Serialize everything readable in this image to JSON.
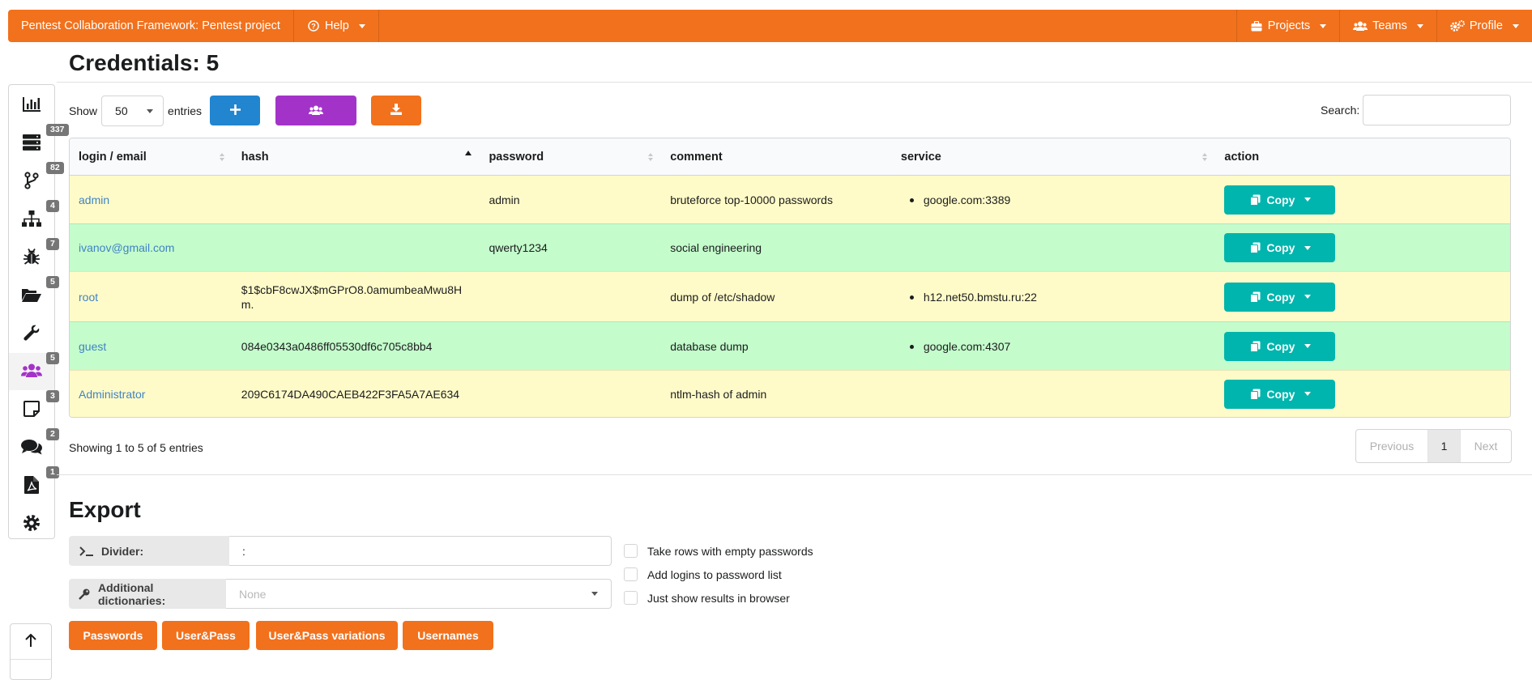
{
  "topbar": {
    "brand": "Pentest Collaboration Framework: Pentest project",
    "help": "Help",
    "projects": "Projects",
    "teams": "Teams",
    "profile": "Profile"
  },
  "sidebar": {
    "items": [
      {
        "icon": "chart-bar-icon",
        "badge": ""
      },
      {
        "icon": "server-icon",
        "badge": "337"
      },
      {
        "icon": "code-branch-icon",
        "badge": "82"
      },
      {
        "icon": "sitemap-icon",
        "badge": "4"
      },
      {
        "icon": "bug-icon",
        "badge": "7"
      },
      {
        "icon": "folder-open-icon",
        "badge": "5"
      },
      {
        "icon": "wrench-icon",
        "badge": ""
      },
      {
        "icon": "users-icon",
        "badge": "5"
      },
      {
        "icon": "sticky-note-icon",
        "badge": "3"
      },
      {
        "icon": "comments-icon",
        "badge": "2"
      },
      {
        "icon": "file-pdf-icon",
        "badge": "1"
      },
      {
        "icon": "cog-icon",
        "badge": ""
      }
    ],
    "scroll_top_icon": "arrow-up-icon"
  },
  "page": {
    "title": "Credentials: 5"
  },
  "controls": {
    "show_label": "Show",
    "entries_value": "50",
    "entries_label": "entries",
    "search_label": "Search:",
    "search_value": ""
  },
  "colors": {
    "accent_orange": "#f2711c",
    "blue": "#2185d0",
    "purple": "#a333c8",
    "teal": "#00b5ad",
    "row_yellow": "#fffbc8",
    "row_green": "#c4fccc"
  },
  "table": {
    "headers": [
      "login / email",
      "hash",
      "password",
      "comment",
      "service",
      "action"
    ],
    "rows": [
      {
        "login": "admin",
        "hash": "",
        "password": "admin",
        "comment": "bruteforce top-10000 passwords",
        "service": "google.com:3389",
        "action": "Copy",
        "color": "yellow"
      },
      {
        "login": "ivanov@gmail.com",
        "hash": "",
        "password": "qwerty1234",
        "comment": "social engineering",
        "service": "",
        "action": "Copy",
        "color": "green"
      },
      {
        "login": "root",
        "hash": "$1$cbF8cwJX$mGPrO8.0amumbeaMwu8Hm.",
        "password": "",
        "comment": "dump of /etc/shadow",
        "service": "h12.net50.bmstu.ru:22",
        "action": "Copy",
        "color": "yellow"
      },
      {
        "login": "guest",
        "hash": "084e0343a0486ff05530df6c705c8bb4",
        "password": "",
        "comment": "database dump",
        "service": "google.com:4307",
        "action": "Copy",
        "color": "green"
      },
      {
        "login": "Administrator",
        "hash": "209C6174DA490CAEB422F3FA5A7AE634",
        "password": "",
        "comment": "ntlm-hash of admin",
        "service": "",
        "action": "Copy",
        "color": "yellow"
      }
    ],
    "info": "Showing 1 to 5 of 5 entries",
    "pagination": {
      "previous": "Previous",
      "page": "1",
      "next": "Next"
    }
  },
  "export": {
    "title": "Export",
    "divider_label": "Divider:",
    "divider_value": ":",
    "dictionaries_label": "Additional dictionaries:",
    "dictionaries_placeholder": "None",
    "checkboxes": [
      "Take rows with empty passwords",
      "Add logins to password list",
      "Just show results in browser"
    ],
    "buttons": [
      "Passwords",
      "User&Pass",
      "User&Pass variations",
      "Usernames"
    ]
  }
}
